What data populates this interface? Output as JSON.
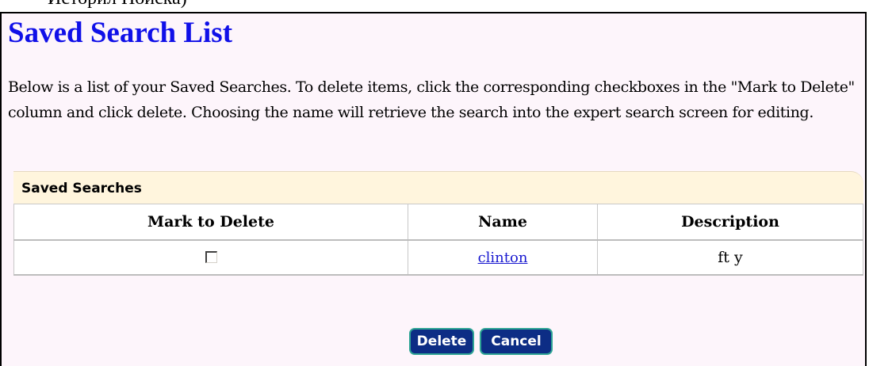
{
  "top_cut_text": "Историл Поиска)",
  "page": {
    "title": "Saved Search List",
    "intro": "Below is a list of your Saved Searches. To delete items, click the corresponding checkboxes in the \"Mark to Delete\" column and click delete. Choosing the name will retrieve the search into the expert search screen for editing."
  },
  "saved_searches": {
    "title": "Saved Searches",
    "columns": [
      "Mark to Delete",
      "Name",
      "Description"
    ],
    "rows": [
      {
        "checked": false,
        "name": "clinton",
        "description": "ft y"
      }
    ]
  },
  "buttons": {
    "delete_label": "Delete",
    "cancel_label": "Cancel"
  },
  "colors": {
    "title": "#1010e8",
    "panel_background": "#fdf5fb",
    "header_background": "#fff5dd",
    "button_background": "#0d2d85",
    "button_border": "#2fa595",
    "link": "#1a1ad0"
  }
}
